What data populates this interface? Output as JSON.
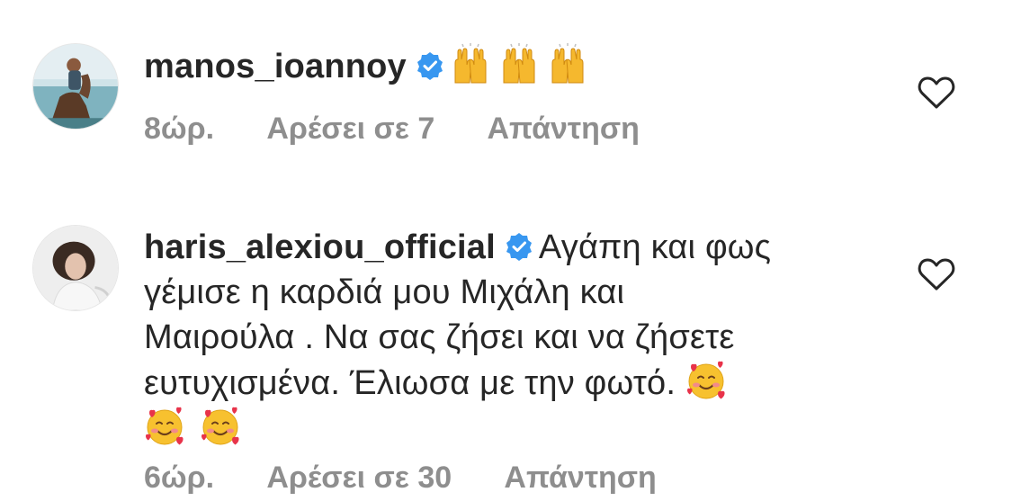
{
  "comments": [
    {
      "username": "manos_ioannoy",
      "verified": true,
      "text": "",
      "emojis": [
        "raising-hands-emoji",
        "raising-hands-emoji",
        "raising-hands-emoji"
      ],
      "time": "8ώρ.",
      "likes": "Αρέσει σε 7",
      "reply": "Απάντηση",
      "avatar": "rider-on-horse-avatar"
    },
    {
      "username": "haris_alexiou_official",
      "verified": true,
      "text_line1": "Αγάπη και φως",
      "text_line2": "γέμισε η καρδιά μου Μιχάλη και",
      "text_line3": "Μαιρούλα . Να σας ζήσει και να ζήσετε",
      "text_line4": "ευτυχισμένα.  Έλιωσα με την φωτό.",
      "emojis": [
        "smiling-face-with-hearts-emoji",
        "smiling-face-with-hearts-emoji",
        "smiling-face-with-hearts-emoji"
      ],
      "time": "6ώρ.",
      "likes": "Αρέσει σε 30",
      "reply": "Απάντηση",
      "avatar": "woman-portrait-avatar"
    }
  ],
  "icons": {
    "verified": "verified-badge-icon",
    "like": "heart-outline-icon"
  },
  "colors": {
    "verified_blue": "#3897f0",
    "meta_gray": "#8e8e8e",
    "text": "#262626"
  }
}
